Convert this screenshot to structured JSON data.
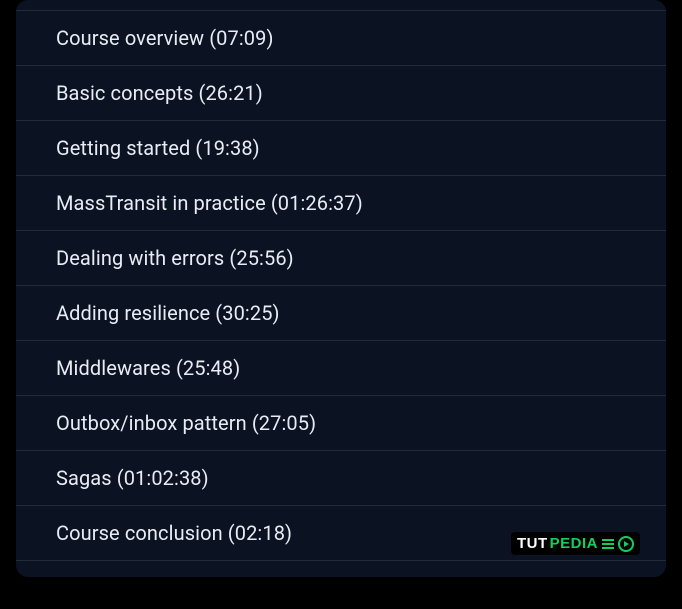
{
  "modules": [
    {
      "title": "Course overview",
      "duration": "07:09"
    },
    {
      "title": "Basic concepts",
      "duration": "26:21"
    },
    {
      "title": "Getting started",
      "duration": "19:38"
    },
    {
      "title": "MassTransit in practice",
      "duration": "01:26:37"
    },
    {
      "title": "Dealing with errors",
      "duration": "25:56"
    },
    {
      "title": "Adding resilience",
      "duration": "30:25"
    },
    {
      "title": "Middlewares",
      "duration": "25:48"
    },
    {
      "title": "Outbox/inbox pattern",
      "duration": "27:05"
    },
    {
      "title": "Sagas",
      "duration": "01:02:38"
    },
    {
      "title": "Course conclusion",
      "duration": "02:18"
    }
  ],
  "logo": {
    "part1": "TUT",
    "part2": "PEDIA"
  }
}
